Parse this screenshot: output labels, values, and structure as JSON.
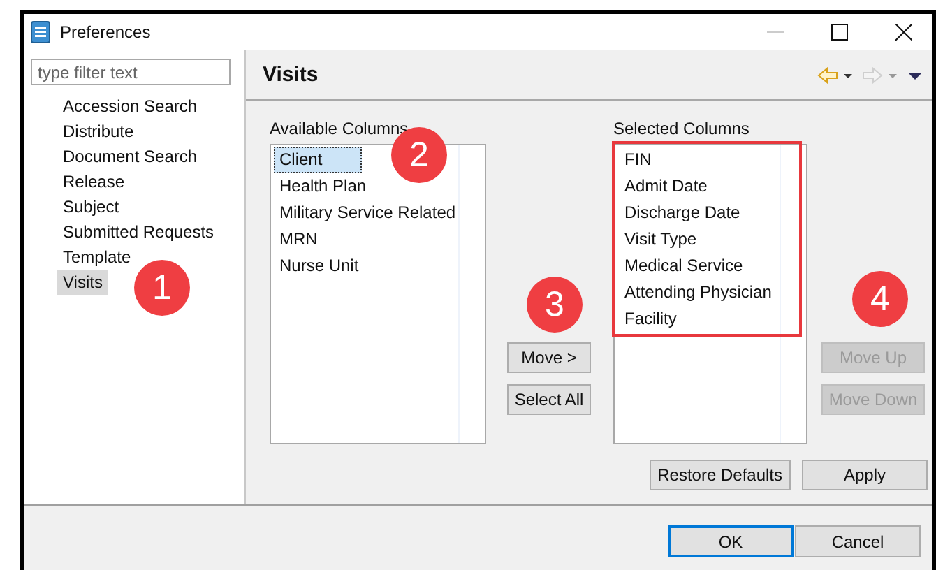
{
  "window": {
    "title": "Preferences"
  },
  "sidebar": {
    "filter": {
      "placeholder": "type filter text"
    },
    "items": [
      {
        "label": "Accession Search",
        "selected": false
      },
      {
        "label": "Distribute",
        "selected": false
      },
      {
        "label": "Document Search",
        "selected": false
      },
      {
        "label": "Release",
        "selected": false
      },
      {
        "label": "Subject",
        "selected": false
      },
      {
        "label": "Submitted Requests",
        "selected": false
      },
      {
        "label": "Template",
        "selected": false
      },
      {
        "label": "Visits",
        "selected": true
      }
    ]
  },
  "page": {
    "title": "Visits",
    "nav": [
      {
        "kind": "back",
        "disabled": false
      },
      {
        "kind": "forward",
        "disabled": true
      },
      {
        "kind": "menu",
        "disabled": false
      }
    ]
  },
  "available_columns": {
    "label": "Available Columns",
    "items": [
      {
        "label": "Client",
        "selected": true
      },
      {
        "label": "Health Plan",
        "selected": false
      },
      {
        "label": "Military Service Related",
        "selected": false
      },
      {
        "label": "MRN",
        "selected": false
      },
      {
        "label": "Nurse Unit",
        "selected": false
      }
    ]
  },
  "move_buttons": [
    {
      "label": "Move >",
      "disabled": false
    },
    {
      "label": "Select All",
      "disabled": false
    }
  ],
  "selected_columns": {
    "label": "Selected Columns",
    "items": [
      {
        "label": "FIN",
        "selected": false
      },
      {
        "label": "Admit Date",
        "selected": false
      },
      {
        "label": "Discharge Date",
        "selected": false
      },
      {
        "label": "Visit Type",
        "selected": false
      },
      {
        "label": "Medical Service",
        "selected": false
      },
      {
        "label": "Attending Physician",
        "selected": false
      },
      {
        "label": "Facility",
        "selected": false
      }
    ]
  },
  "order_buttons": [
    {
      "label": "Move Up",
      "disabled": true
    },
    {
      "label": "Move Down",
      "disabled": true
    }
  ],
  "page_buttons": [
    {
      "label": "Restore Defaults",
      "disabled": false
    },
    {
      "label": "Apply",
      "disabled": false
    }
  ],
  "dialog_buttons": [
    {
      "label": "OK",
      "default": true
    },
    {
      "label": "Cancel",
      "default": false
    }
  ],
  "callouts": [
    "1",
    "2",
    "3",
    "4"
  ]
}
